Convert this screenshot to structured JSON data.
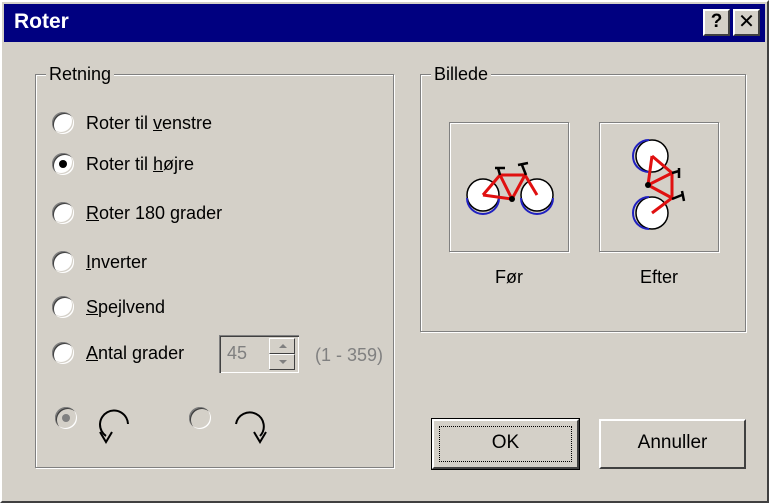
{
  "window": {
    "title": "Roter"
  },
  "titlebar": {
    "help_label": "?",
    "close_label": "✕"
  },
  "direction": {
    "legend": "Retning",
    "options": [
      {
        "pre": "Roter til ",
        "u": "v",
        "post": "enstre",
        "checked": false
      },
      {
        "pre": "Roter til ",
        "u": "h",
        "post": "øjre",
        "checked": true
      },
      {
        "pre": "",
        "u": "R",
        "post": "oter 180 grader",
        "checked": false
      },
      {
        "pre": "",
        "u": "I",
        "post": "nverter",
        "checked": false
      },
      {
        "pre": "",
        "u": "S",
        "post": "pejlvend",
        "checked": false
      },
      {
        "pre": "",
        "u": "A",
        "post": "ntal grader",
        "checked": false
      }
    ],
    "degrees_value": "45",
    "degrees_range": "(1 - 359)",
    "ccw_selected": true,
    "cw_selected": false
  },
  "picture": {
    "legend": "Billede",
    "before_label": "Før",
    "after_label": "Efter"
  },
  "buttons": {
    "ok": "OK",
    "cancel": "Annuller"
  },
  "colors": {
    "titlebar": "#000080",
    "frame": "#e01010",
    "wheel_shadow": "#2020c0"
  }
}
